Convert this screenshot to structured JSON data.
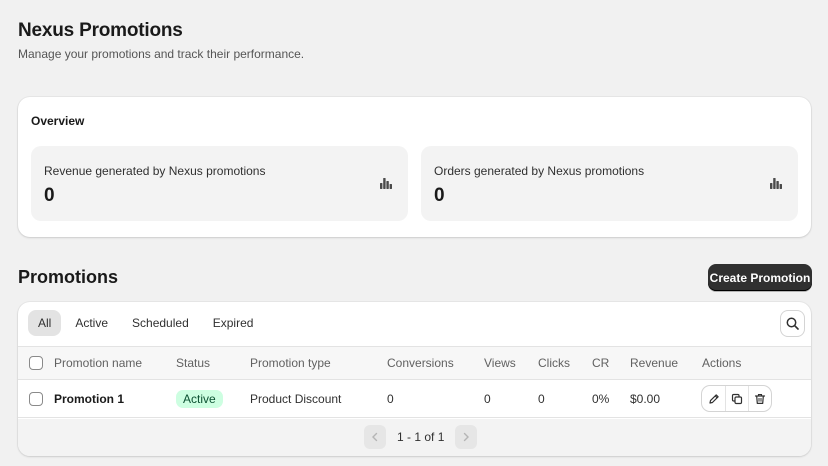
{
  "header": {
    "title": "Nexus Promotions",
    "subtitle": "Manage your promotions and track their performance."
  },
  "overview": {
    "title": "Overview",
    "stats": [
      {
        "label": "Revenue generated by Nexus promotions",
        "value": "0",
        "icon": "bar-chart-icon"
      },
      {
        "label": "Orders generated by Nexus promotions",
        "value": "0",
        "icon": "bar-chart-icon"
      }
    ]
  },
  "promotions": {
    "title": "Promotions",
    "create_label": "Create Promotion",
    "tabs": [
      "All",
      "Active",
      "Scheduled",
      "Expired"
    ],
    "active_tab": "All",
    "columns": [
      "Promotion name",
      "Status",
      "Promotion type",
      "Conversions",
      "Views",
      "Clicks",
      "CR",
      "Revenue",
      "Actions"
    ],
    "rows": [
      {
        "name": "Promotion 1",
        "status": "Active",
        "type": "Product Discount",
        "conversions": "0",
        "views": "0",
        "clicks": "0",
        "cr": "0%",
        "revenue": "$0.00",
        "actions": [
          "edit-icon",
          "duplicate-icon",
          "delete-icon"
        ]
      }
    ],
    "pagination": "1 - 1 of 1"
  },
  "colors": {
    "primary_button": "#303030",
    "badge_success_bg": "#cdfee1",
    "badge_success_text": "#0c5132",
    "page_bg": "#f1f1f1"
  }
}
